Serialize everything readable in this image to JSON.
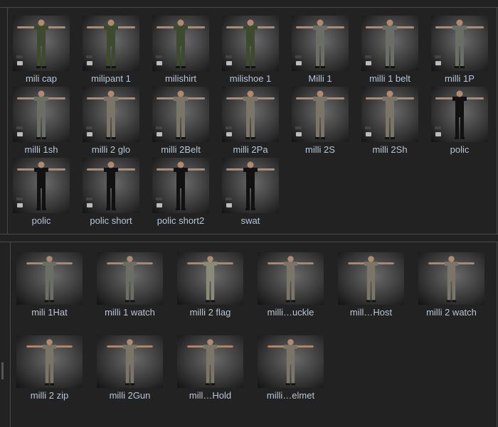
{
  "top_panel": {
    "items": [
      {
        "label": "mili cap",
        "outfit": "#3e4a2e"
      },
      {
        "label": "milipant 1",
        "outfit": "#3e4a2e"
      },
      {
        "label": "milishirt",
        "outfit": "#3e4a2e"
      },
      {
        "label": "milishoe 1",
        "outfit": "#3e4a2e"
      },
      {
        "label": "Milli 1",
        "outfit": "#6b6e64"
      },
      {
        "label": "milli 1 belt",
        "outfit": "#6b6e64"
      },
      {
        "label": "milli 1P",
        "outfit": "#6b6e64"
      },
      {
        "label": "milli 1sh",
        "outfit": "#6b6e64"
      },
      {
        "label": "milli 2 glo",
        "outfit": "#7a7566"
      },
      {
        "label": "milli 2Belt",
        "outfit": "#7a7566"
      },
      {
        "label": "milli 2Pa",
        "outfit": "#7a7566"
      },
      {
        "label": "milli 2S",
        "outfit": "#7a7566"
      },
      {
        "label": "milli 2Sh",
        "outfit": "#7a7566"
      },
      {
        "label": "polic",
        "outfit": "#111111"
      },
      {
        "label": "polic",
        "outfit": "#111111"
      },
      {
        "label": "polic short",
        "outfit": "#111111"
      },
      {
        "label": "polic short2",
        "outfit": "#111111"
      },
      {
        "label": "swat",
        "outfit": "#111111"
      }
    ]
  },
  "bottom_panel": {
    "items": [
      {
        "label": "mili 1Hat",
        "outfit": "#6b6e64"
      },
      {
        "label": "milli 1 watch",
        "outfit": "#6b6e64"
      },
      {
        "label": "milli 2 flag",
        "outfit": "#8a8a78"
      },
      {
        "label": "milli…uckle",
        "outfit": "#7a7566"
      },
      {
        "label": "mill…Host",
        "outfit": "#7a7566"
      },
      {
        "label": "milli 2 watch",
        "outfit": "#7a7566"
      },
      {
        "label": "milli 2 zip",
        "outfit": "#7a7566"
      },
      {
        "label": "milli 2Gun",
        "outfit": "#7a7566"
      },
      {
        "label": "mill…Hold",
        "outfit": "#7a7566"
      },
      {
        "label": "milli…elmet",
        "outfit": "#7a7566"
      }
    ]
  }
}
